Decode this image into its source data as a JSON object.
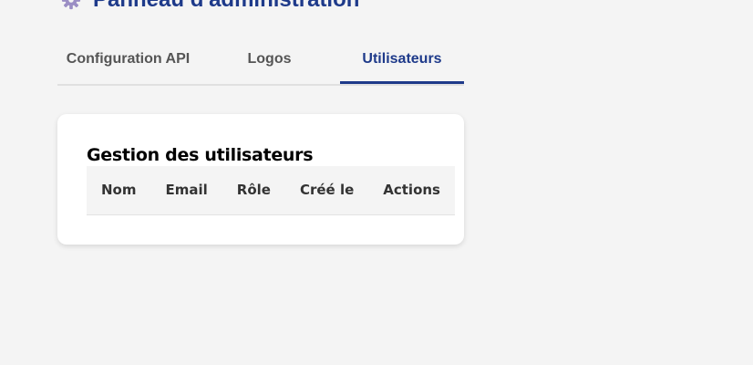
{
  "header": {
    "icon": "gear-icon",
    "title": "Panneau d'administration",
    "icon_color": "#9b8ec4",
    "title_color": "#1e3a8a"
  },
  "tabs": [
    {
      "label": "Configuration API",
      "active": false
    },
    {
      "label": "Logos",
      "active": false
    },
    {
      "label": "Utilisateurs",
      "active": true
    }
  ],
  "users_panel": {
    "title": "Gestion des utilisateurs",
    "columns": [
      "Nom",
      "Email",
      "Rôle",
      "Créé le",
      "Actions"
    ],
    "rows": []
  },
  "colors": {
    "accent": "#1e3a8a",
    "background": "#f4f4f4",
    "card": "#ffffff"
  }
}
